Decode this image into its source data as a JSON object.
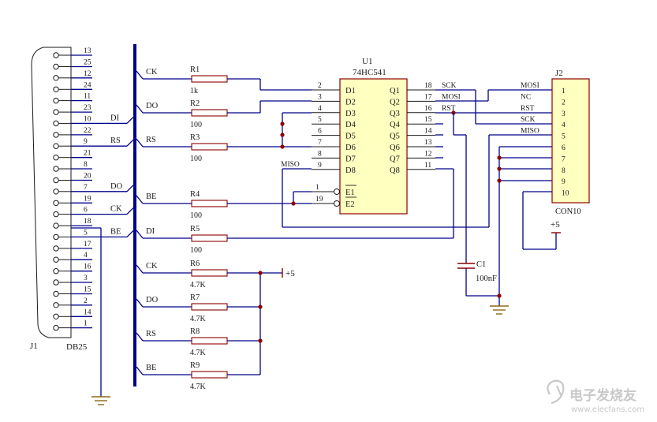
{
  "db25": {
    "ref": "J1",
    "value": "DB25",
    "pins_upper": [
      "13",
      "12",
      "11",
      "10",
      "9",
      "8",
      "7",
      "6",
      "5",
      "4",
      "3",
      "2",
      "1"
    ],
    "pins_lower": [
      "25",
      "24",
      "23",
      "22",
      "21",
      "20",
      "19",
      "18",
      "17",
      "16",
      "15",
      "14"
    ]
  },
  "bus_net_labels": [
    {
      "name": "DI",
      "pin": "10"
    },
    {
      "name": "RS",
      "pin": "9"
    },
    {
      "name": "DO",
      "pin": "7"
    },
    {
      "name": "CK",
      "pin": "6"
    },
    {
      "name": "BE",
      "pin": "5"
    }
  ],
  "resistors": [
    {
      "ref": "R1",
      "value": "1k",
      "net": "CK"
    },
    {
      "ref": "R2",
      "value": "100",
      "net": "DO"
    },
    {
      "ref": "R3",
      "value": "100",
      "net": "RS"
    },
    {
      "ref": "R4",
      "value": "100",
      "net": "BE"
    },
    {
      "ref": "R5",
      "value": "100",
      "net": "DI"
    },
    {
      "ref": "R6",
      "value": "4.7K",
      "net": "CK"
    },
    {
      "ref": "R7",
      "value": "4.7K",
      "net": "DO"
    },
    {
      "ref": "R8",
      "value": "4.7K",
      "net": "RS"
    },
    {
      "ref": "R9",
      "value": "4.7K",
      "net": "BE"
    }
  ],
  "buffer": {
    "ref": "U1",
    "part": "74HC541",
    "d_pins": [
      {
        "num": "2",
        "name": "D1"
      },
      {
        "num": "3",
        "name": "D2"
      },
      {
        "num": "4",
        "name": "D3"
      },
      {
        "num": "5",
        "name": "D4"
      },
      {
        "num": "6",
        "name": "D5"
      },
      {
        "num": "7",
        "name": "D6"
      },
      {
        "num": "8",
        "name": "D7"
      },
      {
        "num": "9",
        "name": "D8"
      }
    ],
    "q_pins": [
      {
        "num": "18",
        "name": "Q1",
        "net": "SCK"
      },
      {
        "num": "17",
        "name": "Q2",
        "net": "MOSI"
      },
      {
        "num": "16",
        "name": "Q3",
        "net": "RST"
      },
      {
        "num": "15",
        "name": "Q4",
        "net": ""
      },
      {
        "num": "14",
        "name": "Q5",
        "net": ""
      },
      {
        "num": "13",
        "name": "Q6",
        "net": ""
      },
      {
        "num": "12",
        "name": "Q7",
        "net": ""
      },
      {
        "num": "11",
        "name": "Q8",
        "net": ""
      }
    ],
    "enable_pins": [
      {
        "num": "1",
        "name": "E1"
      },
      {
        "num": "19",
        "name": "E2"
      }
    ],
    "miso_label": "MISO"
  },
  "header": {
    "ref": "J2",
    "value": "CON10",
    "pins": [
      "1",
      "2",
      "3",
      "4",
      "5",
      "6",
      "7",
      "8",
      "9",
      "10"
    ],
    "nets": [
      "MOSI",
      "NC",
      "RST",
      "SCK",
      "MISO"
    ],
    "supply": "+5"
  },
  "capacitor": {
    "ref": "C1",
    "value": "100nF"
  },
  "pullup_supply": "+5",
  "watermark": {
    "cn": "电子发烧友",
    "url": "www.elecfans.com"
  }
}
